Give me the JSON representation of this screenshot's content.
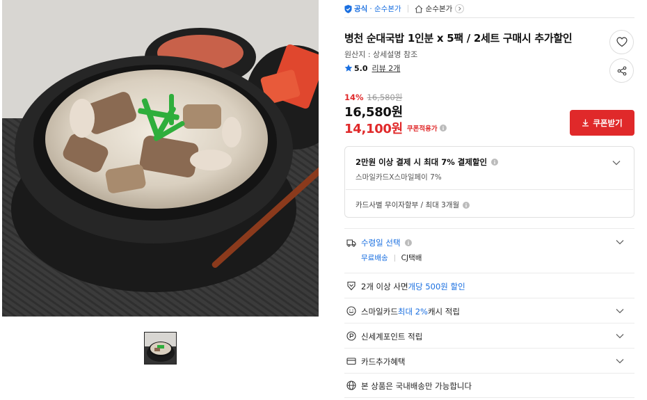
{
  "brand": {
    "official_label": "공식",
    "store_name": "· 순수본가",
    "store_link_label": "순수본가"
  },
  "product": {
    "title": "병천 순대국밥 1인분 x 5팩 / 2세트 구매시 추가할인",
    "origin": "원산지 : 상세설명 참조",
    "rating_score": "5.0",
    "review_label": "리뷰 2개"
  },
  "price": {
    "discount_pct": "14%",
    "original": "16,580원",
    "sale": "16,580원",
    "coupon_price": "14,100원",
    "coupon_label": "쿠폰적용가"
  },
  "coupon_button": {
    "label": "쿠폰받기"
  },
  "benefit": {
    "title": "2만원 이상 결제 시 최대 7% 결제할인",
    "subtitle": "스마일카드X스마일페이 7%",
    "installment": "카드사별 무이자할부 / 최대 3개월"
  },
  "delivery": {
    "title": "수령일 선택",
    "free": "무료배송",
    "carrier": "CJ택배"
  },
  "multi_buy": {
    "prefix": "2개 이상 사면 ",
    "highlight": "개당 500원 할인"
  },
  "smilecard": {
    "prefix": "스마일카드 ",
    "highlight": "최대 2%",
    "suffix": " 캐시 적립"
  },
  "shinsegae": {
    "label": "신세계포인트 적립"
  },
  "card_benefit": {
    "label": "카드추가혜택"
  },
  "domestic": {
    "label": "본 상품은 국내배송만 가능합니다"
  },
  "colors": {
    "accent_red": "#e0292a",
    "accent_blue": "#1a6fe0"
  },
  "icons": {
    "shield": "official-shield-icon",
    "home": "home-icon",
    "heart": "heart-icon",
    "share": "share-icon",
    "star": "star-icon",
    "download": "download-icon",
    "truck": "truck-icon",
    "tag": "tag-icon",
    "smile": "smile-icon",
    "point": "point-icon",
    "card": "card-icon",
    "globe": "globe-icon"
  }
}
